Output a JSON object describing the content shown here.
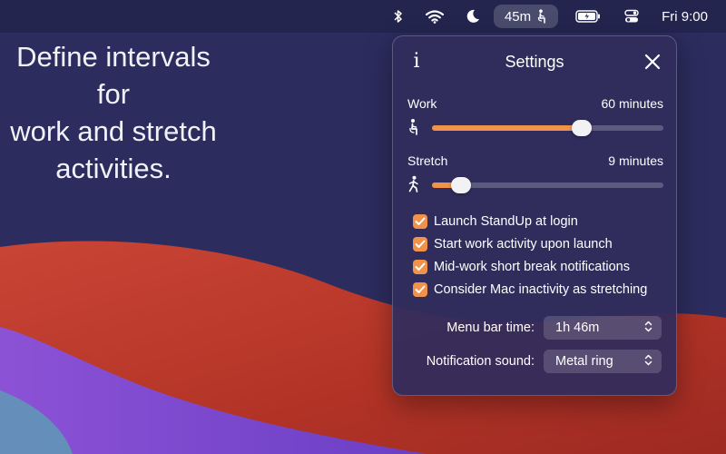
{
  "menubar": {
    "icons": [
      "bluetooth-icon",
      "wifi-icon",
      "moon-icon",
      "battery-icon",
      "control-center-icon"
    ],
    "standup_time": "45m",
    "clock": "Fri 9:00"
  },
  "caption": {
    "lines": [
      "Define intervals",
      "for",
      "work and stretch",
      "activities."
    ]
  },
  "settings": {
    "title": "Settings",
    "work": {
      "label": "Work",
      "value_text": "60 minutes",
      "level": 0.648
    },
    "stretch": {
      "label": "Stretch",
      "value_text": "9 minutes",
      "level": 0.127
    },
    "options": [
      {
        "label": "Launch StandUp at login",
        "checked": true
      },
      {
        "label": "Start work activity upon launch",
        "checked": true
      },
      {
        "label": "Mid-work short break notifications",
        "checked": true
      },
      {
        "label": "Consider Mac inactivity as stretching",
        "checked": true
      }
    ],
    "menu_bar_time": {
      "label": "Menu bar time:",
      "value": "1h 46m"
    },
    "notification_sound": {
      "label": "Notification sound:",
      "value": "Metal ring"
    }
  },
  "colors": {
    "accent": "#f0924a",
    "panel": "#302c5c",
    "wallpaper_red": "#c0392b",
    "wallpaper_purple": "#7d3cc0"
  }
}
